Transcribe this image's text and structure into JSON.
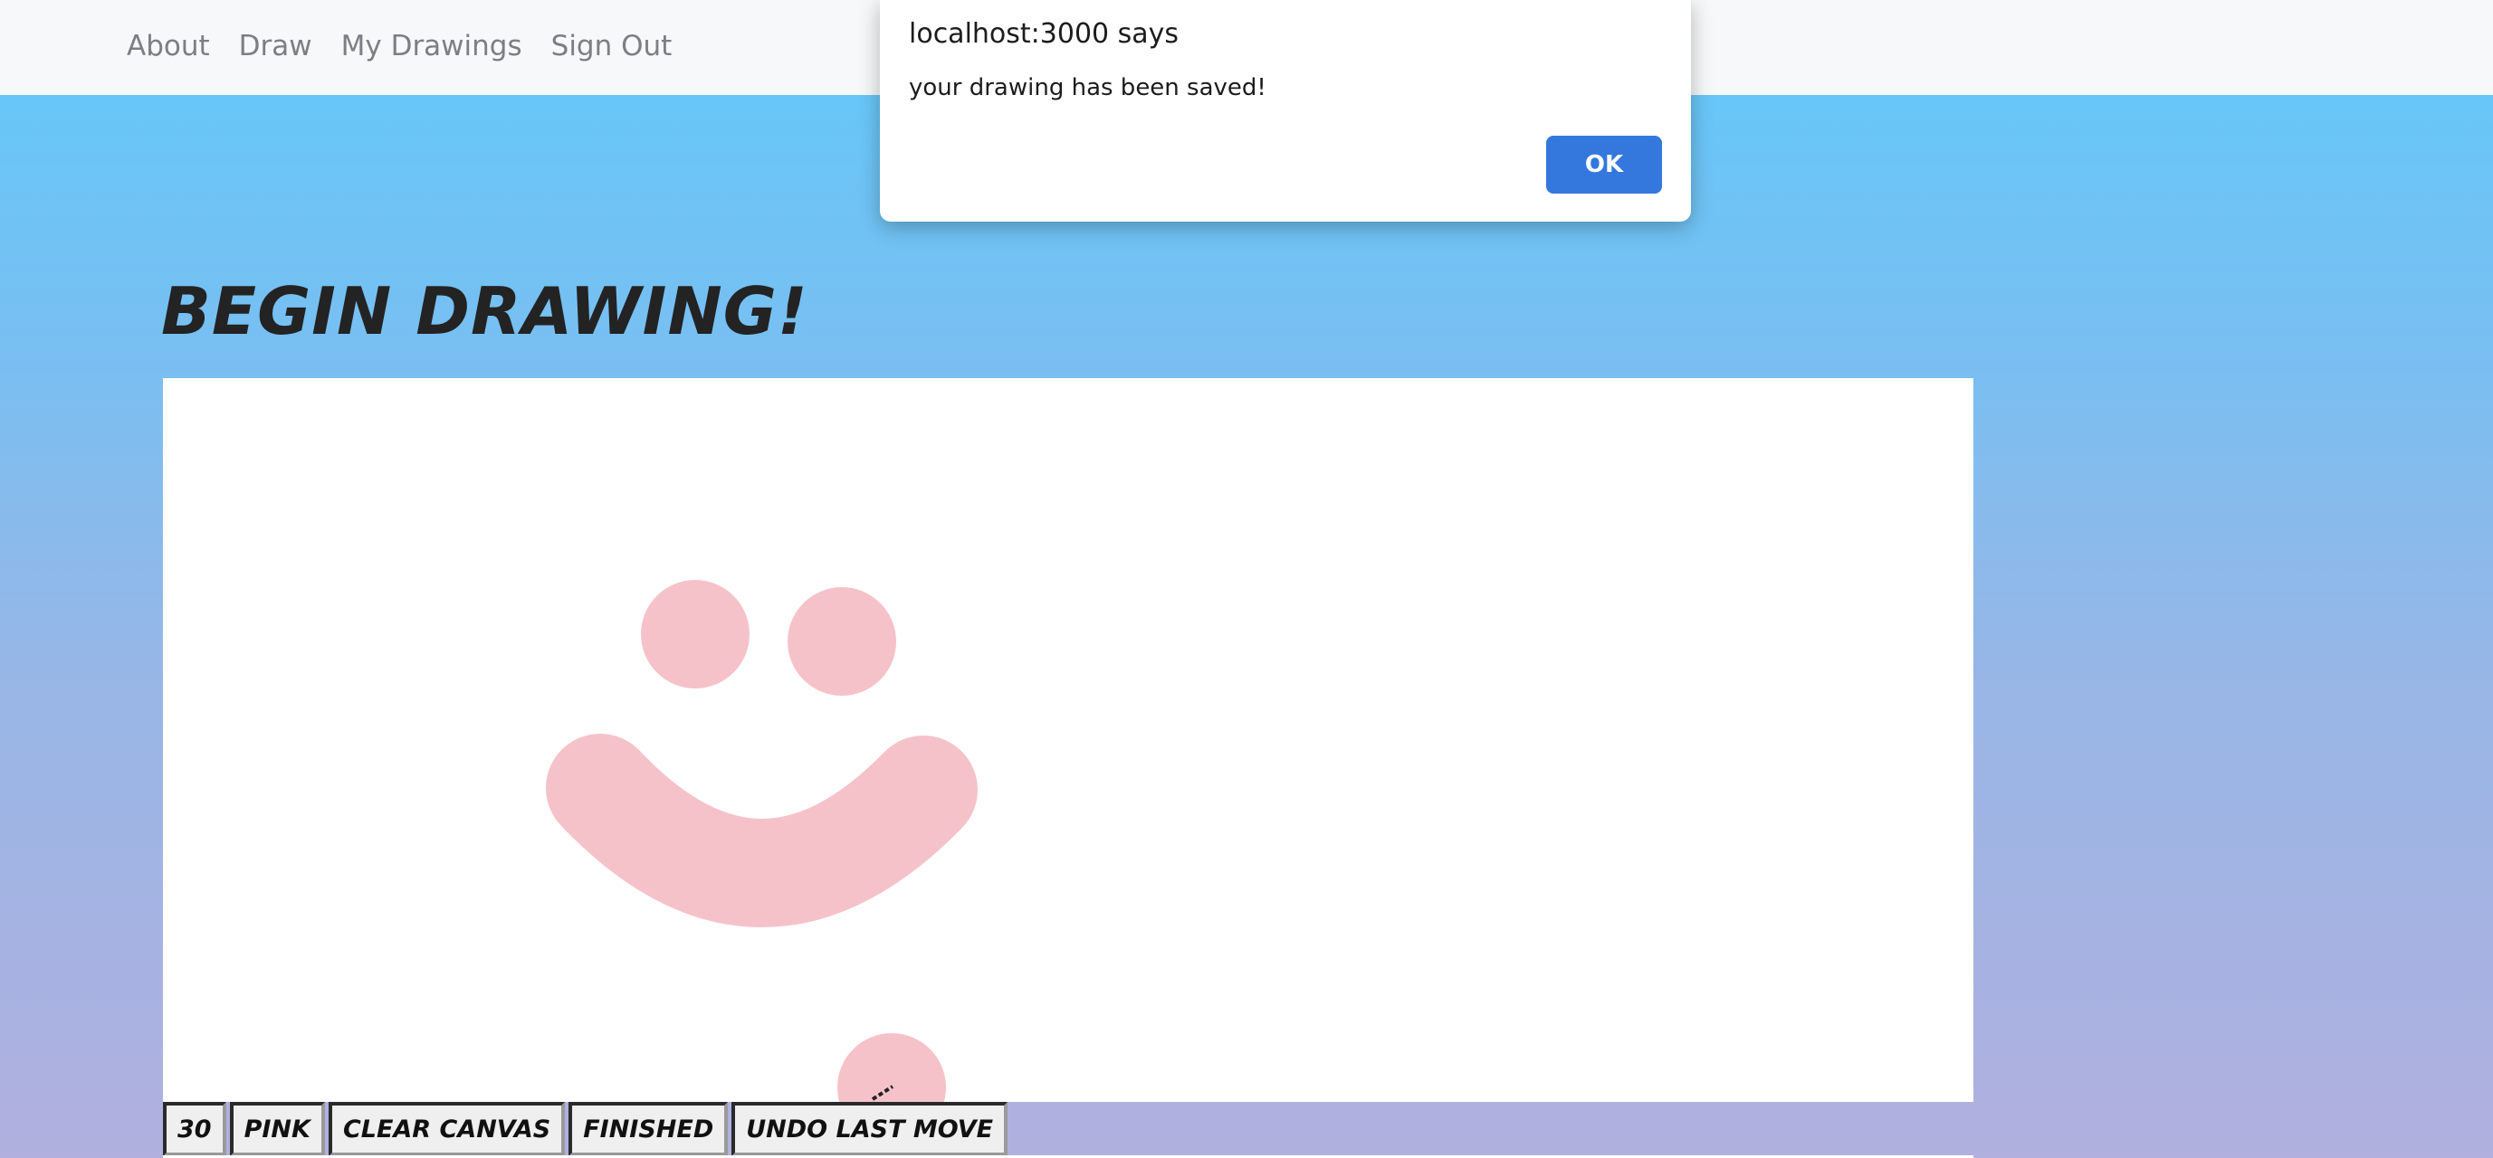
{
  "nav": {
    "items": [
      "About",
      "Draw",
      "My Drawings",
      "Sign Out"
    ]
  },
  "page": {
    "title": "Begin Drawing!"
  },
  "toolbar": {
    "brush_size": "30",
    "color": "Pink",
    "clear_label": "Clear Canvas",
    "finished_label": "Finished",
    "undo_label": "Undo Last Move"
  },
  "canvas": {
    "stroke_color": "#f6c2ca",
    "drawing": "smiley face"
  },
  "dialog": {
    "title": "localhost:3000 says",
    "message": "your drawing has been saved!",
    "ok_label": "OK"
  },
  "colors": {
    "navbar_bg": "#f7f8f9",
    "gradient_top": "#62c9fa",
    "gradient_bottom": "#b1b0df",
    "ok_button": "#3478de"
  }
}
